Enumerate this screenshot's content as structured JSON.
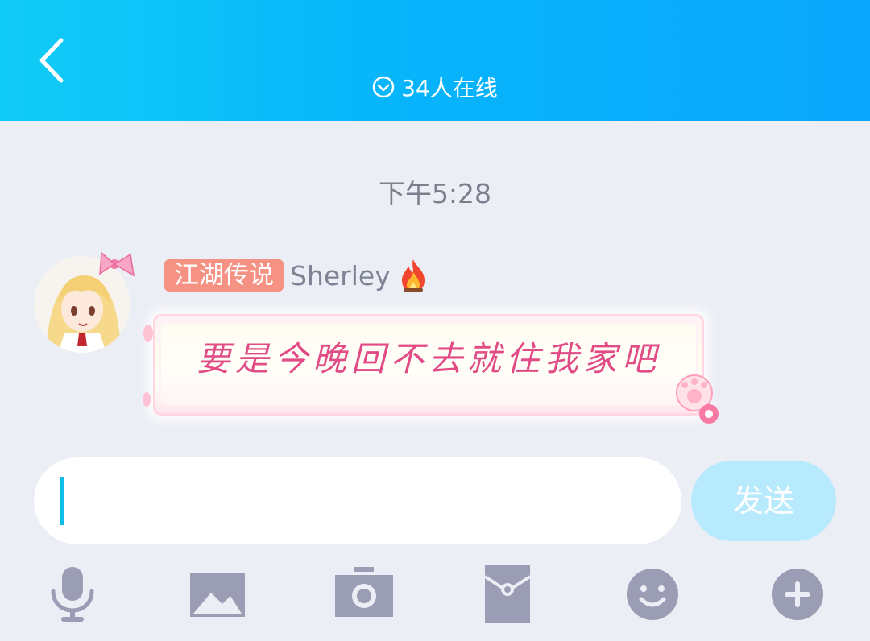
{
  "header": {
    "back_icon": "chevron-left-icon",
    "online_icon": "circle-chevron-down-icon",
    "online_text": "34人在线"
  },
  "chat": {
    "timestamp": "下午5:28",
    "message": {
      "avatar": "anime-girl-avatar",
      "title_badge": "江湖传说",
      "sender": "Sherley",
      "sender_icon": "fire-icon",
      "text": "要是今晚回不去就住我家吧"
    }
  },
  "composer": {
    "input_value": "",
    "send_label": "发送"
  },
  "toolbar": {
    "items": [
      "microphone-icon",
      "image-icon",
      "camera-icon",
      "red-packet-icon",
      "emoji-icon",
      "plus-icon"
    ]
  },
  "colors": {
    "header_start": "#11ccf6",
    "header_end": "#0aa7fc",
    "badge": "#f59283",
    "message_text": "#e14b86",
    "send_button": "#b6eafc",
    "toolbar_icon": "#9a9db4"
  }
}
